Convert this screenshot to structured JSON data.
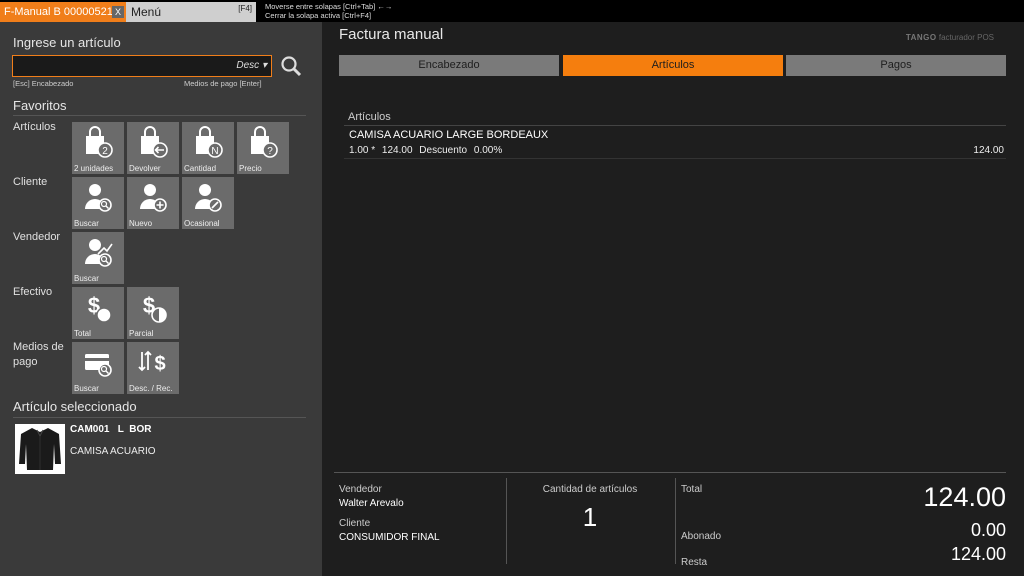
{
  "topbar": {
    "doc_tab": "F-Manual B 00000521",
    "doc_tab_close": "X",
    "menu_tab": "Menú",
    "menu_key": "[F4]",
    "hint_switch": "Moverse entre solapas [Ctrl+Tab] ←→",
    "hint_close": "Cerrar la solapa activa [Ctrl+F4]"
  },
  "left": {
    "search_title": "Ingrese un artículo",
    "search_order": "Desc",
    "hint_header": "[Esc] Encabezado",
    "hint_payment": "Medios de pago [Enter]",
    "favorites_title": "Favoritos",
    "groups": {
      "articulos": "Artículos",
      "cliente": "Cliente",
      "vendedor": "Vendedor",
      "efectivo": "Efectivo",
      "medios_line1": "Medios de",
      "medios_line2": "pago"
    },
    "tiles": {
      "art_units": "2 unidades",
      "art_return": "Devolver",
      "art_qty": "Cantidad",
      "art_price": "Precio",
      "cli_search": "Buscar",
      "cli_new": "Nuevo",
      "cli_occasional": "Ocasional",
      "ven_search": "Buscar",
      "cash_total": "Total",
      "cash_partial": "Parcial",
      "pay_search": "Buscar",
      "pay_disc": "Desc. / Rec."
    },
    "selected_title": "Artículo seleccionado",
    "selected_code": "CAM001   L  BOR",
    "selected_desc": "CAMISA ACUARIO"
  },
  "right": {
    "title": "Factura manual",
    "brand_name": "TANGO",
    "brand_product": "facturador POS",
    "tabs": [
      "Encabezado",
      "Artículos",
      "Pagos"
    ],
    "items_header": "Artículos",
    "item": {
      "name": "CAMISA ACUARIO LARGE BORDEAUX",
      "qty": "1.00 *",
      "price": "124.00",
      "discount_label": "Descuento",
      "discount": "0.00%",
      "total": "124.00"
    },
    "summary": {
      "seller_label": "Vendedor",
      "seller": "Walter Arevalo",
      "client_label": "Cliente",
      "client": "CONSUMIDOR FINAL",
      "qty_label": "Cantidad de artículos",
      "qty": "1",
      "total_label": "Total",
      "total": "124.00",
      "paid_label": "Abonado",
      "paid": "0.00",
      "rest_label": "Resta",
      "rest": "124.00"
    }
  },
  "colors": {
    "accent": "#f57e0e",
    "tile": "#6b6b6b",
    "panel": "#3a3a3a",
    "background": "#1e1e1e"
  }
}
